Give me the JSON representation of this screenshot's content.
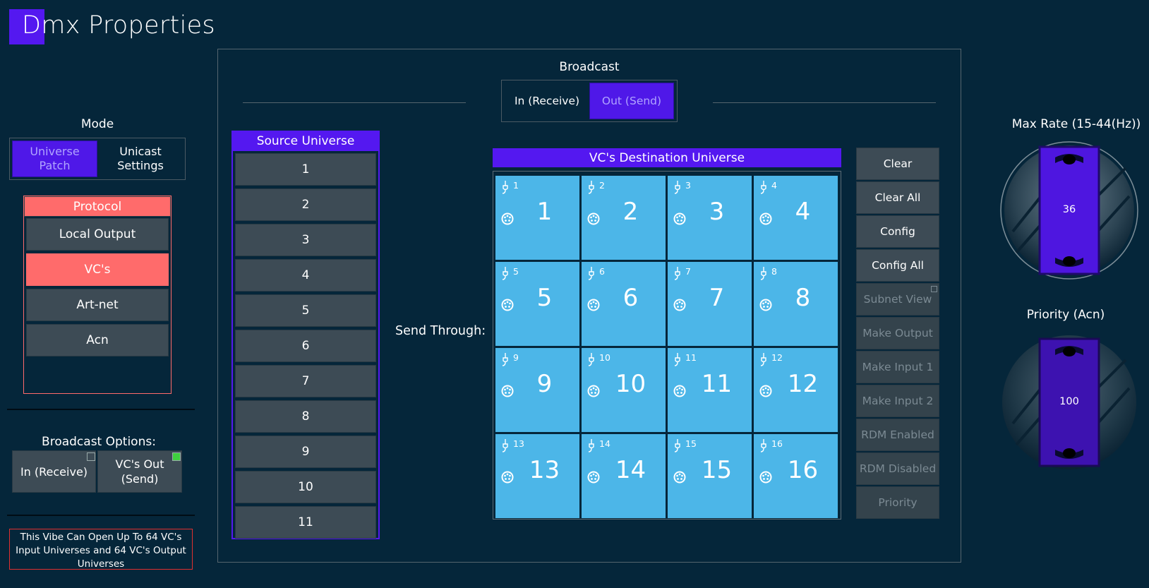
{
  "window": {
    "title": "Dmx Properties"
  },
  "mode": {
    "label": "Mode",
    "universe_patch_line1": "Universe",
    "universe_patch_line2": "Patch",
    "unicast_line1": "Unicast",
    "unicast_line2": "Settings"
  },
  "protocol": {
    "header": "Protocol",
    "items": [
      {
        "label": "Local Output",
        "selected": false
      },
      {
        "label": "VC's",
        "selected": true
      },
      {
        "label": "Art-net",
        "selected": false
      },
      {
        "label": "Acn",
        "selected": false
      }
    ]
  },
  "broadcast_options": {
    "label": "Broadcast Options:",
    "in_label": "In (Receive)",
    "out_line1": "VC's Out",
    "out_line2": "(Send)",
    "in_checked": false,
    "out_checked": true
  },
  "info_text": "This Vibe Can Open Up To 64 VC's Input Universes and 64 VC's Output Universes",
  "broadcast": {
    "label": "Broadcast",
    "in_label": "In (Receive)",
    "out_label": "Out (Send)",
    "selected": "out"
  },
  "source_universe": {
    "header": "Source Universe",
    "items": [
      "1",
      "2",
      "3",
      "4",
      "5",
      "6",
      "7",
      "8",
      "9",
      "10",
      "11"
    ]
  },
  "send_through_label": "Send Through:",
  "vc_destination": {
    "header": "VC's Destination Universe",
    "cells": [
      "1",
      "2",
      "3",
      "4",
      "5",
      "6",
      "7",
      "8",
      "9",
      "10",
      "11",
      "12",
      "13",
      "14",
      "15",
      "16"
    ]
  },
  "side_buttons": [
    {
      "label": "Clear",
      "enabled": true
    },
    {
      "label": "Clear All",
      "enabled": true
    },
    {
      "label": "Config",
      "enabled": true
    },
    {
      "label": "Config All",
      "enabled": true
    },
    {
      "label": "Subnet View",
      "enabled": false
    },
    {
      "label": "Make Output",
      "enabled": false
    },
    {
      "label": "Make Input 1",
      "enabled": false
    },
    {
      "label": "Make Input 2",
      "enabled": false
    },
    {
      "label": "RDM Enabled",
      "enabled": false
    },
    {
      "label": "RDM Disabled",
      "enabled": false
    },
    {
      "label": "Priority",
      "enabled": false
    }
  ],
  "max_rate": {
    "label": "Max Rate (15-44(Hz))",
    "value": "36"
  },
  "priority": {
    "label": "Priority (Acn)",
    "value": "100"
  },
  "colors": {
    "background": "#05263a",
    "accent_purple": "#5418f0",
    "protocol_red": "#ff6b6b",
    "cell_blue": "#4cb6e8",
    "indicator_green": "#3fd03f"
  }
}
